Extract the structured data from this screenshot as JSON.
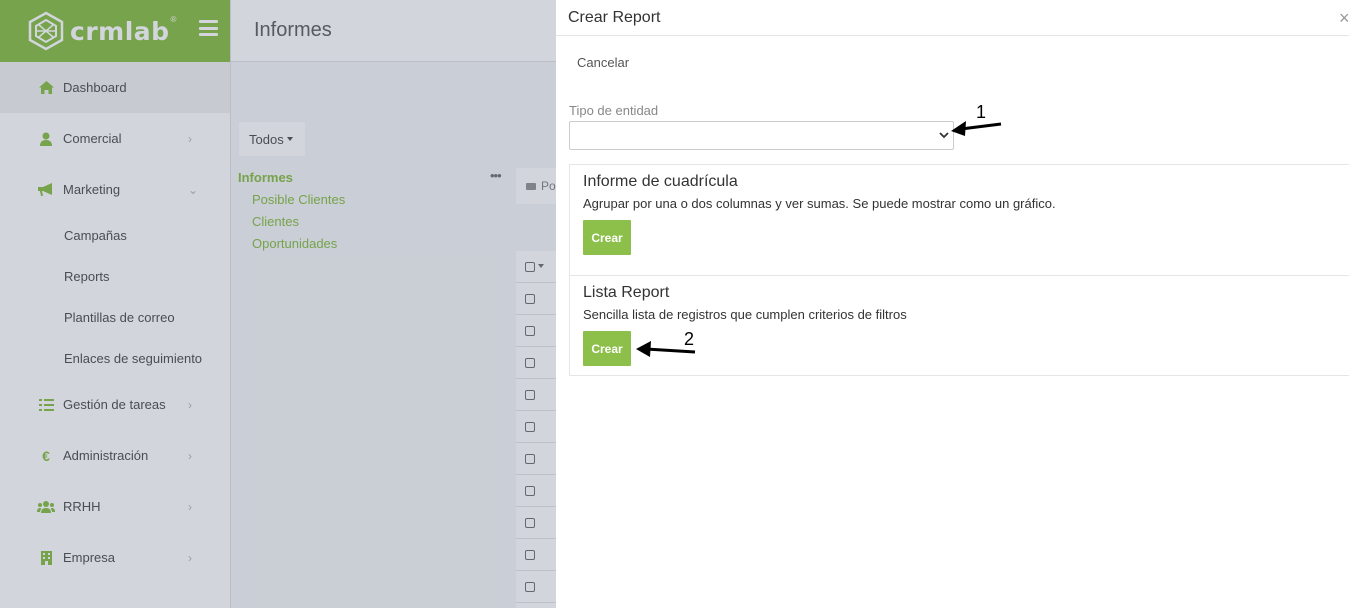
{
  "brand": {
    "name": "crmlab",
    "reg_mark": "®"
  },
  "colors": {
    "accent": "#8dc04a",
    "overlay": "rgba(30,50,80,0.2)"
  },
  "sidebar": {
    "items": [
      {
        "label": "Dashboard",
        "icon": "home-icon"
      },
      {
        "label": "Comercial",
        "icon": "user-icon"
      },
      {
        "label": "Marketing",
        "icon": "bullhorn-icon"
      },
      {
        "label": "Gestión de tareas",
        "icon": "tasks-icon"
      },
      {
        "label": "Administración",
        "icon": "euro-icon"
      },
      {
        "label": "RRHH",
        "icon": "users-icon"
      },
      {
        "label": "Empresa",
        "icon": "building-icon"
      }
    ],
    "marketing_sub": [
      "Campañas",
      "Reports",
      "Plantillas de correo",
      "Enlaces de seguimiento"
    ]
  },
  "page": {
    "title": "Informes",
    "filter_label": "Todos",
    "folder_title": "Informes",
    "folder_more": "•••",
    "folder_links": [
      "Posible Clientes",
      "Clientes",
      "Oportunidades"
    ],
    "breadcrumb": "Po"
  },
  "modal": {
    "title": "Crear Report",
    "close": "×",
    "cancel_label": "Cancelar",
    "entity_label": "Tipo de entidad",
    "entity_value": "",
    "cards": [
      {
        "title": "Informe de cuadrícula",
        "description": "Agrupar por una o dos columnas y ver sumas. Se puede mostrar como un gráfico.",
        "button": "Crear"
      },
      {
        "title": "Lista Report",
        "description": "Sencilla lista de registros que cumplen criterios de filtros",
        "button": "Crear"
      }
    ]
  },
  "annotations": {
    "one": "1",
    "two": "2"
  }
}
